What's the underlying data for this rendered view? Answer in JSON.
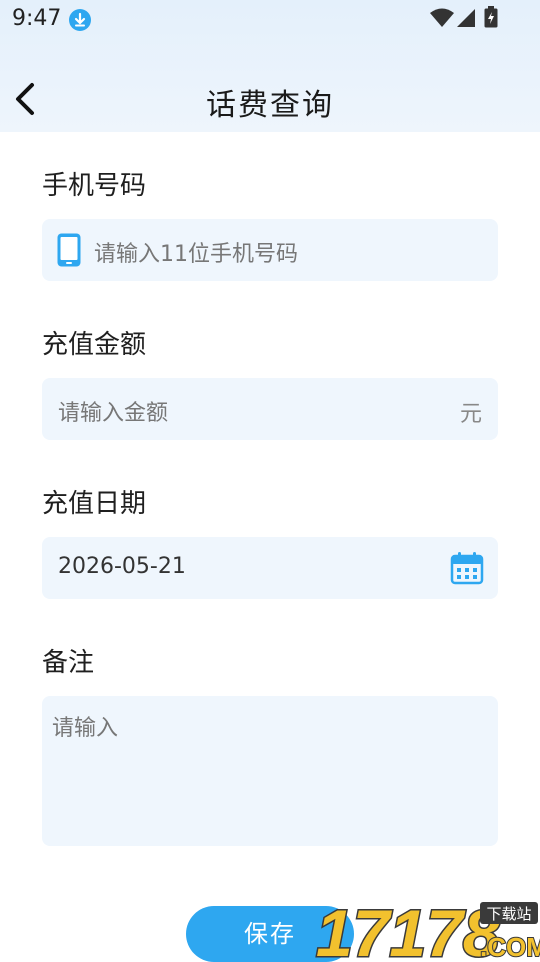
{
  "status_bar": {
    "time": "9:47"
  },
  "header": {
    "title": "话费查询"
  },
  "form": {
    "phone": {
      "label": "手机号码",
      "placeholder": "请输入11位手机号码"
    },
    "amount": {
      "label": "充值金额",
      "placeholder": "请输入金额",
      "unit": "元"
    },
    "date": {
      "label": "充值日期",
      "value": "2026-05-21"
    },
    "remark": {
      "label": "备注",
      "placeholder": "请输入"
    }
  },
  "actions": {
    "save_label": "保存"
  },
  "watermark": {
    "site_text": "17178",
    "tag": "下载站",
    "suffix": ".COM"
  },
  "colors": {
    "accent": "#2ea7f0",
    "field_bg": "#eff6fd",
    "header_bg": "#e4f0fb"
  }
}
